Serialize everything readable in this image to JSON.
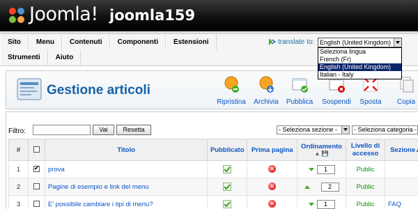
{
  "header": {
    "brand": "Joomla!",
    "site_name": "joomla159"
  },
  "menu": {
    "row1": [
      "Sito",
      "Menu",
      "Contenuti",
      "Componenti",
      "Estensioni"
    ],
    "row2": [
      "Strumenti",
      "Aiuto"
    ]
  },
  "translate": {
    "label": "translate to:",
    "selected": "English (United Kingdom)",
    "options": [
      "Seleziona lingua",
      "French (Fr)",
      "English (United Kingdom)",
      "Italian - Italy"
    ]
  },
  "toolbar": {
    "title": "Gestione articoli",
    "buttons": [
      "Ripristina",
      "Archivia",
      "Pubblica",
      "Sospendi",
      "Sposta",
      "Copia"
    ]
  },
  "filter": {
    "label": "Filtro:",
    "go_label": "Vai",
    "reset_label": "Resetta",
    "section_select": "- Seleziona sezione -",
    "category_select": "- Seleziona categoria -"
  },
  "table": {
    "headers": {
      "num": "#",
      "title": "Titolo",
      "published": "Pubblicato",
      "frontpage": "Prima pagina",
      "order": "Ordinamento",
      "access": "Livello di accesso",
      "section": "Sezione"
    },
    "rows": [
      {
        "num": "1",
        "title": "prova",
        "checked": true,
        "order": "1",
        "access": "Public",
        "section": ""
      },
      {
        "num": "2",
        "title": "Pagine di esempio e link del menu",
        "checked": false,
        "order": "2",
        "access": "Public",
        "section": ""
      },
      {
        "num": "3",
        "title": "E' possibile cambiare i tipi di menu?",
        "checked": false,
        "order": "1",
        "access": "Public",
        "section": "FAQ"
      }
    ]
  },
  "colors": {
    "accent": "#0b55c4",
    "title_blue": "#1561a7",
    "access_green": "#0a8f0a",
    "header_black": "#111111"
  }
}
